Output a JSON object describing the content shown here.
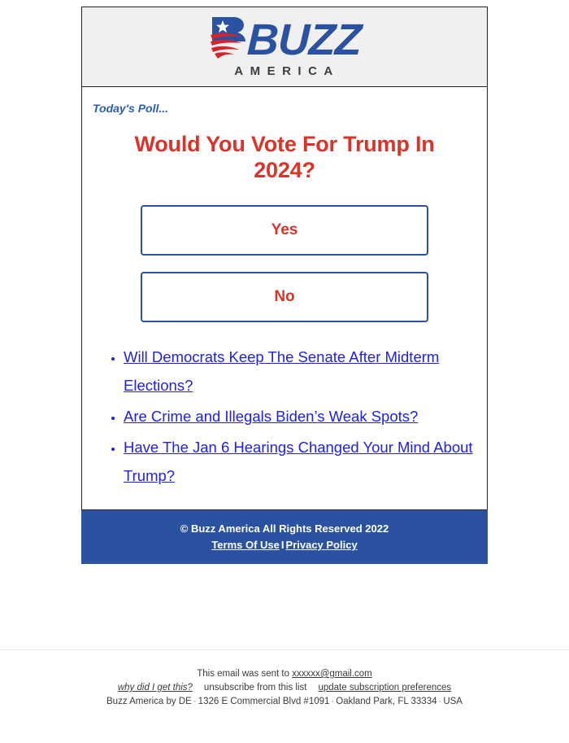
{
  "logo": {
    "mark_name": "buzz-america-flag-b-mark",
    "word": "BUZZ",
    "subtitle": "AMERICA",
    "blue": "#2B52A0",
    "red": "#d8232a",
    "subtitle_color": "#3a3f45"
  },
  "poll": {
    "kicker": "Today's Poll...",
    "question": "Would You Vote For Trump In 2024?",
    "options": [
      {
        "label": "Yes"
      },
      {
        "label": "No"
      }
    ],
    "question_color": "#da342a",
    "kicker_color": "#2B5CB8",
    "button_border_color": "#2B52A0"
  },
  "topics": [
    {
      "label": "Will Democrats Keep The Senate After Midterm Elections?"
    },
    {
      "label": "Are Crime and Illegals Biden’s Weak Spots?"
    },
    {
      "label": "Have The Jan 6 Hearings Changed Your Mind About Trump?"
    }
  ],
  "footer": {
    "copyright": "© Buzz America All Rights Reserved 2022",
    "terms_label": "Terms Of Use",
    "separator": "I",
    "privacy_label": "Privacy Policy",
    "background": "#2B52A0"
  },
  "fineprint": {
    "sent_to_prefix": "This email was sent to ",
    "recipient_email": "xxxxxx@gmail.com",
    "why_label": "why did I get this?",
    "unsubscribe_label": "unsubscribe from this list",
    "update_prefs_label": "update subscription preferences",
    "address_parts": {
      "company": "Buzz America by DE",
      "street": "1326 E Commercial Blvd #1091",
      "city_state_zip": "Oakland Park, FL 33334",
      "country": "USA"
    },
    "address_separator": "·"
  }
}
